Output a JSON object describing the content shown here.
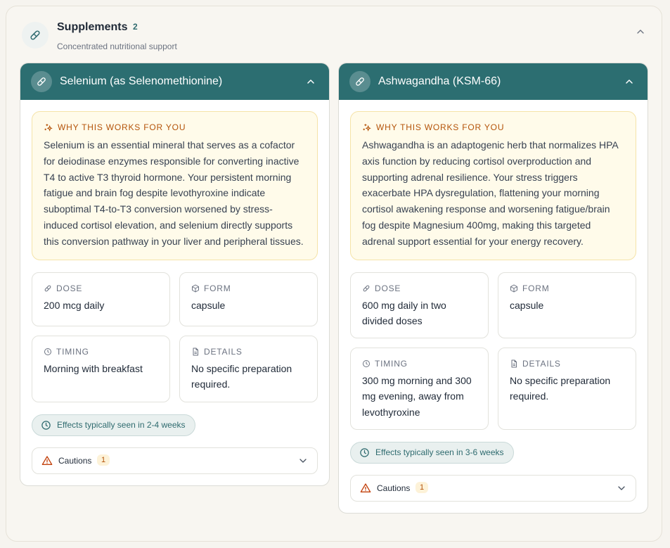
{
  "section": {
    "title": "Supplements",
    "count": "2",
    "subtitle": "Concentrated nutritional support",
    "icon": "pill-icon"
  },
  "colors": {
    "accent": "#2c6e71",
    "why_bg": "#fffbea",
    "why_label": "#b45309"
  },
  "cards": [
    {
      "name": "Selenium (as Selenomethionine)",
      "why_label": "WHY THIS WORKS FOR YOU",
      "why_text": "Selenium is an essential mineral that serves as a cofactor for deiodinase enzymes responsible for converting inactive T4 to active T3 thyroid hormone. Your persistent morning fatigue and brain fog despite levothyroxine indicate suboptimal T4-to-T3 conversion worsened by stress-induced cortisol elevation, and selenium directly supports this conversion pathway in your liver and peripheral tissues.",
      "dose_label": "DOSE",
      "dose": "200 mcg daily",
      "form_label": "FORM",
      "form": "capsule",
      "timing_label": "TIMING",
      "timing": "Morning with breakfast",
      "details_label": "DETAILS",
      "details": "No specific preparation required.",
      "effects": "Effects typically seen in 2-4 weeks",
      "cautions_label": "Cautions",
      "cautions_count": "1"
    },
    {
      "name": "Ashwagandha (KSM-66)",
      "why_label": "WHY THIS WORKS FOR YOU",
      "why_text": "Ashwagandha is an adaptogenic herb that normalizes HPA axis function by reducing cortisol overproduction and supporting adrenal resilience. Your stress triggers exacerbate HPA dysregulation, flattening your morning cortisol awakening response and worsening fatigue/brain fog despite Magnesium 400mg, making this targeted adrenal support essential for your energy recovery.",
      "dose_label": "DOSE",
      "dose": "600 mg daily in two divided doses",
      "form_label": "FORM",
      "form": "capsule",
      "timing_label": "TIMING",
      "timing": "300 mg morning and 300 mg evening, away from levothyroxine",
      "details_label": "DETAILS",
      "details": "No specific preparation required.",
      "effects": "Effects typically seen in 3-6 weeks",
      "cautions_label": "Cautions",
      "cautions_count": "1"
    }
  ]
}
